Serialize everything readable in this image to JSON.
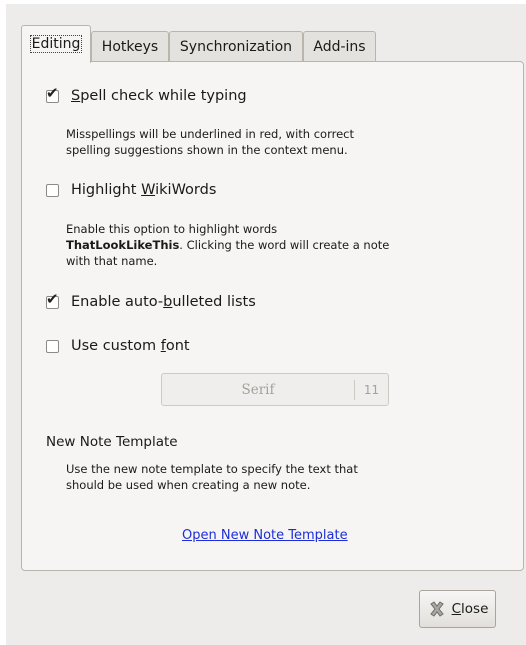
{
  "tabs": [
    {
      "label": "Editing",
      "active": true
    },
    {
      "label": "Hotkeys",
      "active": false
    },
    {
      "label": "Synchronization",
      "active": false
    },
    {
      "label": "Add-ins",
      "active": false
    }
  ],
  "editing": {
    "spell_check": {
      "label_mnemonic": "S",
      "label_rest": "pell check while typing",
      "checked": true
    },
    "spell_check_desc_line1": "Misspellings will be underlined in red, with correct",
    "spell_check_desc_line2": "spelling suggestions shown in the context menu.",
    "wikiwords": {
      "label_prefix": "Highlight ",
      "label_mnemonic": "W",
      "label_rest": "ikiWords",
      "checked": false
    },
    "wikiwords_desc_line1": "Enable this option to highlight words",
    "wikiwords_desc_bold": "ThatLookLikeThis",
    "wikiwords_desc_line2_rest": ". Clicking the word will create a note",
    "wikiwords_desc_line3": "with that name.",
    "bulleted": {
      "label_prefix": "Enable auto-",
      "label_mnemonic": "b",
      "label_rest": "ulleted lists",
      "checked": true
    },
    "custom_font": {
      "label_prefix": "Use custom ",
      "label_mnemonic": "f",
      "label_rest": "ont",
      "checked": false
    },
    "font_button": {
      "family": "Serif",
      "size": "11"
    },
    "template_title": "New Note Template",
    "template_desc_line1": "Use the new note template to specify the text that",
    "template_desc_line2": "should be used when creating a new note.",
    "template_link": "Open New Note Template"
  },
  "footer": {
    "close_mnemonic": "C",
    "close_rest": "lose",
    "close_icon": "close-x-icon"
  }
}
